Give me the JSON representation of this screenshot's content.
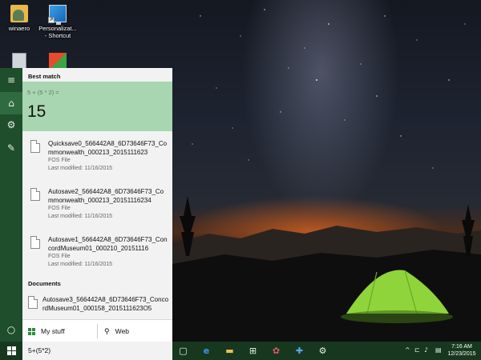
{
  "desktop": {
    "icons": [
      {
        "label": "winaero",
        "icon": "user-folder-icon"
      },
      {
        "label": "Personalizat... - Shortcut",
        "icon": "personalization-shortcut-icon"
      },
      {
        "label": "",
        "icon": "recycle-bin-icon"
      },
      {
        "label": "",
        "icon": "windows-program-icon"
      }
    ]
  },
  "rail": {
    "items": [
      {
        "icon": "hamburger-menu-icon",
        "glyph": "≡"
      },
      {
        "icon": "home-icon",
        "glyph": "⌂"
      },
      {
        "icon": "settings-gear-icon",
        "glyph": "⚙"
      },
      {
        "icon": "feedback-icon",
        "glyph": "✎"
      },
      {
        "icon": "cortana-circle-icon",
        "glyph": "○"
      }
    ]
  },
  "search_panel": {
    "best_match_label": "Best match",
    "expression": "5 + (5 * 2) =",
    "result": "15",
    "files": [
      {
        "name": "Quicksave0_566442A8_6D73646F73_Commonwealth_000213_2015111623",
        "type": "FOS File",
        "modified": "Last modified: 11/16/2015"
      },
      {
        "name": "Autosave2_566442A8_6D73646F73_Commonwealth_000213_20151116234",
        "type": "FOS File",
        "modified": "Last modified: 11/16/2015"
      },
      {
        "name": "Autosave1_566442A8_6D73646F73_ConcordMuseum01_000210_20151116",
        "type": "FOS File",
        "modified": "Last modified: 11/16/2015"
      }
    ],
    "documents_label": "Documents",
    "document_item": "Autosave3_566442A8_6D73646F73_ConcordMuseum01_000158_2015111623O5",
    "my_stuff_label": "My stuff",
    "web_label": "Web"
  },
  "taskbar": {
    "search_text": "5+(5*2)",
    "apps": [
      {
        "icon": "task-view-icon",
        "glyph": "▢"
      },
      {
        "icon": "edge-browser-icon",
        "glyph": "e"
      },
      {
        "icon": "file-explorer-icon",
        "glyph": "▬"
      },
      {
        "icon": "store-icon",
        "glyph": "⊞"
      },
      {
        "icon": "paint-app-icon",
        "glyph": "✿"
      },
      {
        "icon": "tools-app-icon",
        "glyph": "✚"
      },
      {
        "icon": "settings-gear-icon",
        "glyph": "⚙"
      }
    ],
    "tray": {
      "chevron": "^",
      "network": "⊏",
      "volume": "♪",
      "notifications": "▤"
    },
    "time": "7:16 AM",
    "date": "12/23/2015"
  },
  "colors": {
    "accent": "#1f4e2d",
    "taskbar": "#17381f",
    "best_match_bg": "#a8d6b0",
    "tent": "#8fd43a"
  }
}
